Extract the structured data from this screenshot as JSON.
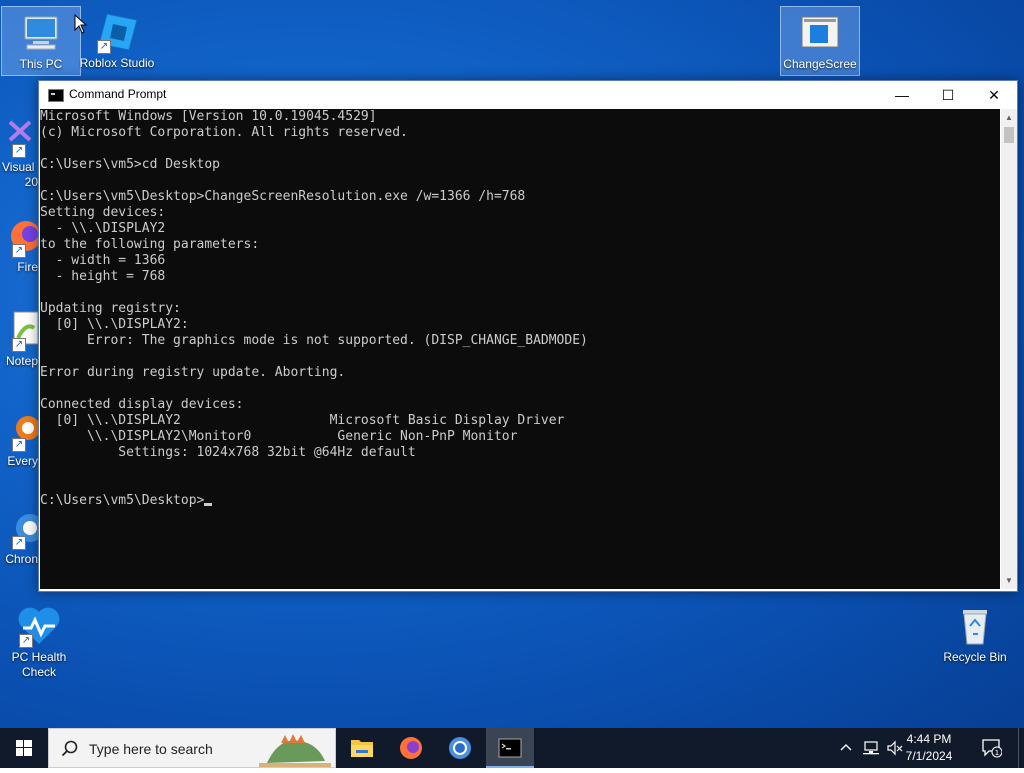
{
  "desktop": {
    "icons": {
      "this_pc": "This PC",
      "roblox": "Roblox Studio",
      "change_screen": "ChangeScree",
      "visual": "Visual",
      "visual_suffix": "20",
      "firefox": "Fire",
      "notepad": "Notep",
      "everything": "Every",
      "chrome": "Chron",
      "pc_health": "PC Health\nCheck",
      "recycle_bin": "Recycle Bin"
    }
  },
  "window": {
    "title": "Command Prompt",
    "controls": {
      "minimize": "—",
      "maximize": "☐",
      "close": "✕"
    },
    "console_lines": [
      "Microsoft Windows [Version 10.0.19045.4529]",
      "(c) Microsoft Corporation. All rights reserved.",
      "",
      "C:\\Users\\vm5>cd Desktop",
      "",
      "C:\\Users\\vm5\\Desktop>ChangeScreenResolution.exe /w=1366 /h=768",
      "Setting devices:",
      "  - \\\\.\\DISPLAY2",
      "to the following parameters:",
      "  - width = 1366",
      "  - height = 768",
      "",
      "Updating registry:",
      "  [0] \\\\.\\DISPLAY2:",
      "      Error: The graphics mode is not supported. (DISP_CHANGE_BADMODE)",
      "",
      "Error during registry update. Aborting.",
      "",
      "Connected display devices:",
      "  [0] \\\\.\\DISPLAY2                   Microsoft Basic Display Driver",
      "      \\\\.\\DISPLAY2\\Monitor0           Generic Non-PnP Monitor",
      "          Settings: 1024x768 32bit @64Hz default",
      "",
      ""
    ],
    "prompt": "C:\\Users\\vm5\\Desktop>"
  },
  "taskbar": {
    "search_placeholder": "Type here to search",
    "time": "4:44 PM",
    "date": "7/1/2024"
  }
}
